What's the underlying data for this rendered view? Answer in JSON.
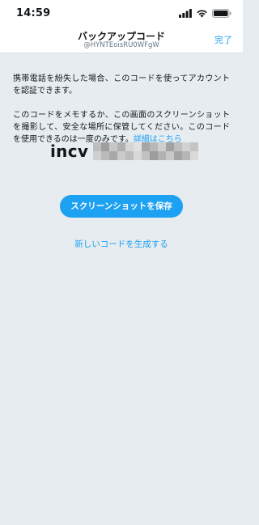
{
  "status_bar": {
    "time": "14:59"
  },
  "nav": {
    "title": "バックアップコード",
    "subtitle": "@HYNTEoisRU0WFgW",
    "done_label": "完了"
  },
  "body": {
    "paragraph1": "携帯電話を紛失した場合、このコードを使ってアカウントを認証できます。",
    "paragraph2": "このコードをメモするか、この画面のスクリーンショットを撮影して、安全な場所に保管してください。このコードを使用できるのは一度のみです。",
    "details_link": "詳細はこちら",
    "code_prefix": "incv",
    "save_button_label": "スクリーンショットを保存",
    "new_code_link": "新しいコードを生成する"
  },
  "colors": {
    "accent": "#1da1f2",
    "background": "#e6ecf0",
    "nav_background": "#ffffff",
    "text": "#14171a",
    "subtext": "#657786"
  }
}
